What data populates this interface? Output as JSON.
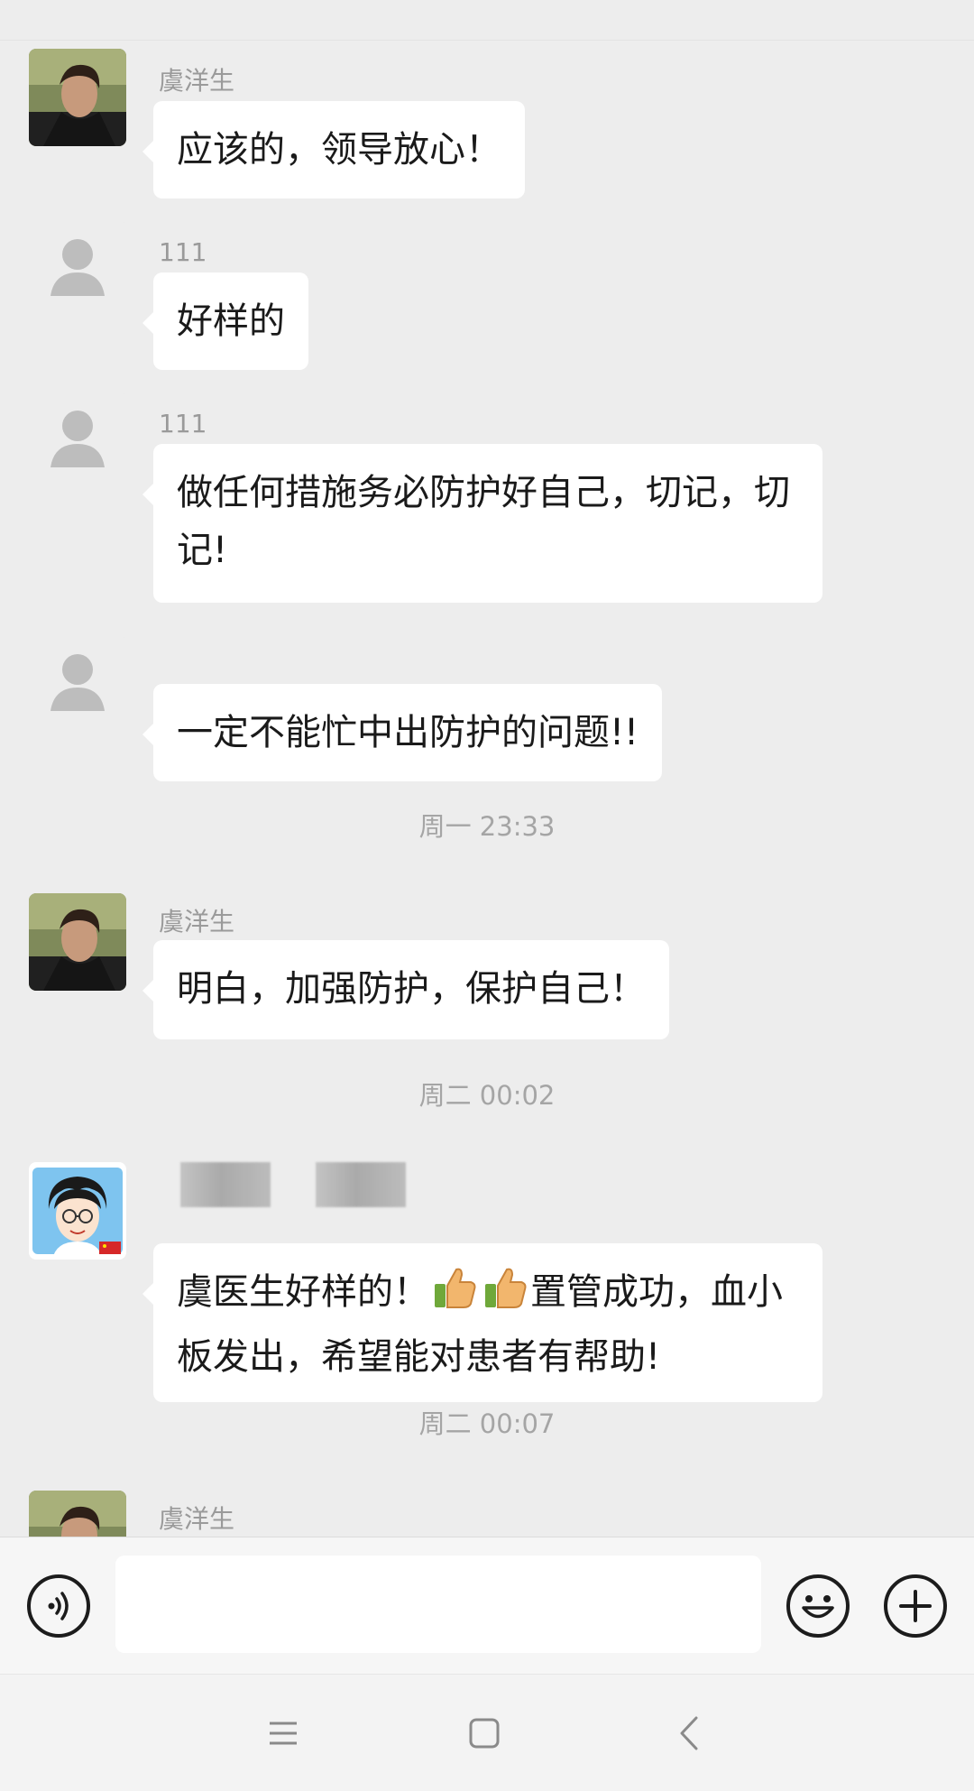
{
  "colors": {
    "background": "#ededed",
    "bubble": "#ffffff",
    "sender_name": "#9a9a9a",
    "timestamp": "#a5a5a5"
  },
  "messages": [
    {
      "sender": "虞洋生",
      "avatar": "man-photo-avatar",
      "text": "应该的，领导放心！"
    },
    {
      "sender": "111",
      "avatar": "default-person-avatar",
      "text": "好样的"
    },
    {
      "sender": "111",
      "avatar": "default-person-avatar",
      "text": "做任何措施务必防护好自己，切记，切记!"
    },
    {
      "sender": "",
      "avatar": "default-person-avatar",
      "text": "一定不能忙中出防护的问题!!"
    },
    {
      "sender": "虞洋生",
      "avatar": "man-photo-avatar",
      "text": "明白，加强防护，保护自己！"
    },
    {
      "sender": "",
      "avatar": "cartoon-doctor-avatar",
      "text_before": "虞医生好样的！",
      "emoji": "thumbs-up-icon",
      "text_after": "置管成功，血小板发出，希望能对患者有帮助!"
    },
    {
      "sender": "虞洋生",
      "avatar": "man-photo-avatar",
      "text": ""
    }
  ],
  "timestamps": [
    "周一 23:33",
    "周二 00:02",
    "周二 00:07"
  ],
  "input_bar": {
    "voice_icon": "voice-icon",
    "emoji_icon": "emoji-icon",
    "more_icon": "plus-icon",
    "input_value": ""
  },
  "nav_bar": {
    "menu_icon": "menu-icon",
    "home_icon": "home-square-icon",
    "back_icon": "back-chevron-icon"
  }
}
